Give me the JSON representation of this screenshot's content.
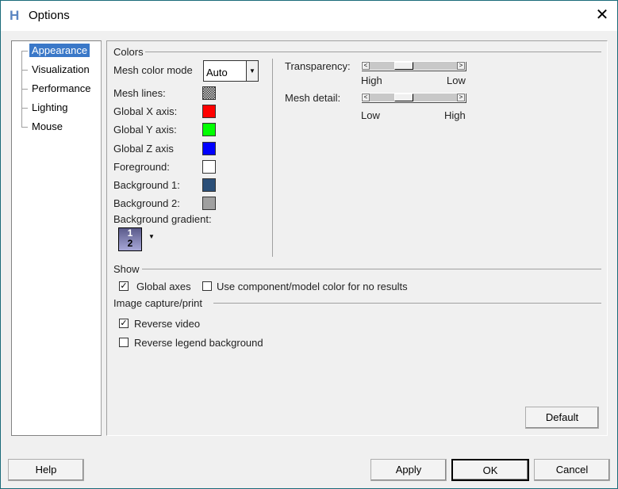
{
  "window": {
    "title": "Options",
    "close_label": "✕"
  },
  "tree": {
    "items": [
      {
        "label": "Appearance",
        "selected": true
      },
      {
        "label": "Visualization"
      },
      {
        "label": "Performance"
      },
      {
        "label": "Lighting"
      },
      {
        "label": "Mouse"
      }
    ]
  },
  "colors": {
    "heading": "Colors",
    "mesh_color_mode": {
      "label": "Mesh color mode",
      "value": "Auto"
    },
    "swatches": [
      {
        "label": "Mesh lines:",
        "color": "#808080"
      },
      {
        "label": "Global X axis:",
        "color": "#ff0000"
      },
      {
        "label": "Global Y axis:",
        "color": "#00ff00"
      },
      {
        "label": "Global Z axis",
        "color": "#0000ff"
      },
      {
        "label": "Foreground:",
        "color": "#ffffff"
      },
      {
        "label": "Background 1:",
        "color": "#2b4f78"
      },
      {
        "label": "Background 2:",
        "color": "#a0a0a0"
      }
    ],
    "gradient": {
      "label": "Background gradient:",
      "top": "1",
      "bottom": "2"
    }
  },
  "transparency": {
    "label": "Transparency:",
    "min_label": "High",
    "max_label": "Low",
    "value": 0.35
  },
  "mesh_detail": {
    "label": "Mesh detail:",
    "min_label": "Low",
    "max_label": "High",
    "value": 0.35
  },
  "show": {
    "heading": "Show",
    "global_axes": {
      "label": "Global axes",
      "checked": true
    },
    "component_color": {
      "label": "Use component/model color for no results",
      "checked": false
    }
  },
  "capture": {
    "heading": "Image capture/print",
    "reverse_video": {
      "label": "Reverse video",
      "checked": true
    },
    "reverse_legend": {
      "label": "Reverse legend background",
      "checked": false
    }
  },
  "buttons": {
    "default": "Default",
    "help": "Help",
    "apply": "Apply",
    "ok": "OK",
    "cancel": "Cancel"
  },
  "check_mark": "✓"
}
